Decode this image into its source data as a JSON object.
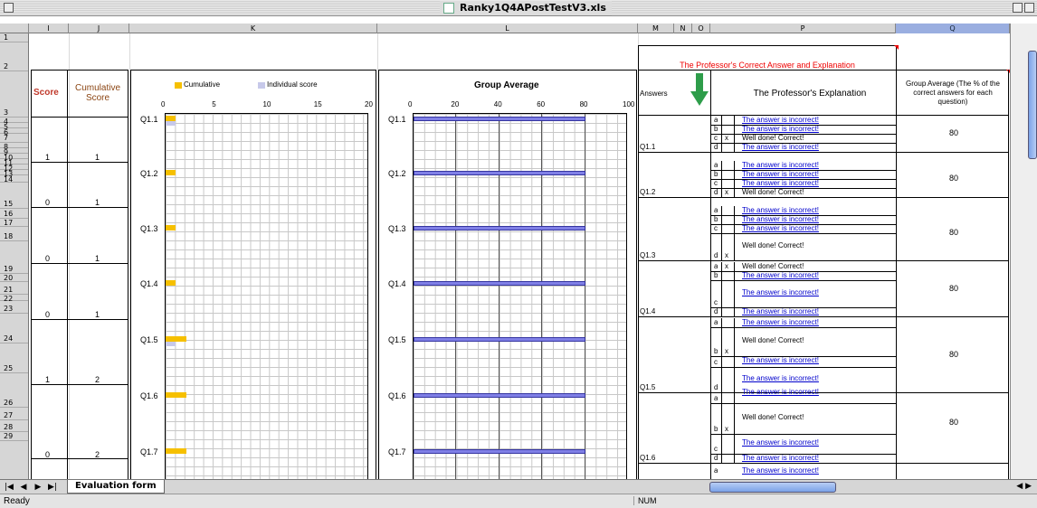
{
  "window": {
    "title": "Ranky1Q4APostTestV3.xls"
  },
  "columns": [
    "I",
    "J",
    "K",
    "L",
    "M",
    "N",
    "O",
    "P",
    "Q"
  ],
  "rows": [
    "1",
    "2",
    "3",
    "4",
    "5",
    "6",
    "7",
    "8",
    "9",
    "10",
    "11",
    "12",
    "13",
    "14",
    "15",
    "16",
    "17",
    "18",
    "19",
    "20",
    "21",
    "22",
    "23",
    "24",
    "25",
    "26",
    "27",
    "28",
    "29"
  ],
  "left_table": {
    "score_header": "Score",
    "cumulative_header": "Cumulative Score",
    "scores": [
      "1",
      "0",
      "0",
      "0",
      "1",
      "",
      "0"
    ],
    "cumulative": [
      "1",
      "1",
      "1",
      "1",
      "2",
      "",
      "2"
    ]
  },
  "chart_data": [
    {
      "type": "bar",
      "legend": [
        "Cumulative",
        "Individual score"
      ],
      "categories": [
        "Q1.1",
        "Q1.2",
        "Q1.3",
        "Q1.4",
        "Q1.5",
        "Q1.6",
        "Q1.7"
      ],
      "series": [
        {
          "name": "Cumulative",
          "values": [
            1,
            1,
            1,
            1,
            2,
            2,
            2
          ]
        },
        {
          "name": "Individual score",
          "values": [
            1,
            0,
            0,
            0,
            1,
            0,
            0
          ]
        }
      ],
      "xticks": [
        "0",
        "5",
        "10",
        "15",
        "20"
      ],
      "xlim": [
        0,
        20
      ],
      "colors": {
        "cumulative": "#f6c000",
        "individual": "#c7c9ea"
      }
    },
    {
      "type": "bar",
      "title": "Group Average",
      "categories": [
        "Q1.1",
        "Q1.2",
        "Q1.3",
        "Q1.4",
        "Q1.5",
        "Q1.6",
        "Q1.7"
      ],
      "values": [
        80,
        80,
        80,
        80,
        80,
        80,
        80
      ],
      "xticks": [
        "0",
        "20",
        "40",
        "60",
        "80",
        "100"
      ],
      "xlim": [
        0,
        100
      ],
      "colors": {
        "bar": "#8080e6"
      }
    }
  ],
  "right_table": {
    "professor_header": "The Professor's Correct Answer and Explanation",
    "answers_header": "Answers",
    "explanation_header": "The Professor's Explanation",
    "group_avg_header": "Group Average (The % of the correct answers for each question)",
    "correct_text": "Well done! Correct!",
    "incorrect_text": "The answer is incorrect!",
    "mark": "x",
    "group_avg_value": "80",
    "questions": [
      {
        "label": "Q1.1",
        "options": [
          "a",
          "b",
          "c",
          "d"
        ],
        "correct": "c"
      },
      {
        "label": "Q1.2",
        "options": [
          "a",
          "b",
          "c",
          "d"
        ],
        "correct": "d"
      },
      {
        "label": "Q1.3",
        "options": [
          "a",
          "b",
          "c",
          "d"
        ],
        "correct": "d"
      },
      {
        "label": "Q1.4",
        "options": [
          "a",
          "b",
          "c",
          "d"
        ],
        "correct": "a"
      },
      {
        "label": "Q1.5",
        "options": [
          "a",
          "b",
          "c",
          "d"
        ],
        "correct": "b"
      },
      {
        "label": "Q1.6",
        "options": [
          "a",
          "b",
          "c",
          "d"
        ],
        "correct": "b"
      }
    ]
  },
  "tabs": {
    "sheet_name": "Evaluation form"
  },
  "status": {
    "ready": "Ready",
    "num": "NUM"
  }
}
